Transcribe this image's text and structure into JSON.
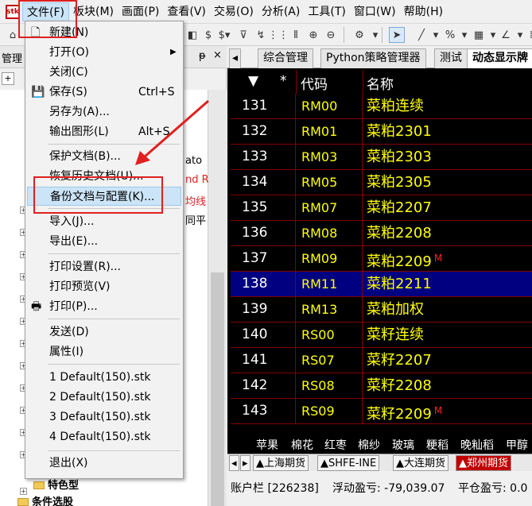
{
  "menubar": {
    "logo": "stk",
    "items": [
      "文件(F)",
      "板块(M)",
      "画面(P)",
      "查看(V)",
      "交易(O)",
      "分析(A)",
      "工具(T)",
      "窗口(W)",
      "帮助(H)"
    ]
  },
  "toolbar": {
    "icons": [
      "home-icon",
      "back-icon",
      "forward-icon",
      "grid-icon",
      "zoom-in-icon",
      "zoom-out-icon",
      "gear-icon",
      "cursor-icon",
      "line-icon",
      "percent-icon",
      "table-icon",
      "angle-icon"
    ]
  },
  "left_panel": {
    "title": "管理",
    "pin": "ᵽ",
    "close": "×",
    "behind_texts": [
      "ato",
      "nd R",
      "均线",
      "同平"
    ],
    "tree": [
      {
        "label": "特色型"
      },
      {
        "label": "条件选股"
      }
    ]
  },
  "file_menu": {
    "items": [
      {
        "label": "新建(N)",
        "shortcut": "",
        "icon": "new-doc"
      },
      {
        "label": "打开(O)",
        "shortcut": "",
        "submenu": true
      },
      {
        "label": "关闭(C)",
        "shortcut": ""
      },
      {
        "label": "保存(S)",
        "shortcut": "Ctrl+S",
        "icon": "save"
      },
      {
        "label": "另存为(A)...",
        "shortcut": ""
      },
      {
        "label": "输出图形(L)",
        "shortcut": "Alt+S"
      },
      {
        "label": "保护文档(B)...",
        "shortcut": ""
      },
      {
        "label": "恢复历史文档(U)...",
        "shortcut": ""
      },
      {
        "label": "备份文档与配置(K)...",
        "shortcut": "",
        "highlighted": true
      },
      {
        "label": "导入(J)...",
        "shortcut": ""
      },
      {
        "label": "导出(E)...",
        "shortcut": ""
      },
      {
        "label": "打印设置(R)...",
        "shortcut": ""
      },
      {
        "label": "打印预览(V)",
        "shortcut": ""
      },
      {
        "label": "打印(P)...",
        "shortcut": "",
        "icon": "print"
      },
      {
        "label": "发送(D)",
        "shortcut": ""
      },
      {
        "label": "属性(I)",
        "shortcut": ""
      },
      {
        "label": "1 Default(150).stk",
        "shortcut": ""
      },
      {
        "label": "2 Default(150).stk",
        "shortcut": ""
      },
      {
        "label": "3 Default(150).stk",
        "shortcut": ""
      },
      {
        "label": "4 Default(150).stk",
        "shortcut": ""
      },
      {
        "label": "退出(X)",
        "shortcut": ""
      }
    ]
  },
  "tabs": [
    "综合管理",
    "Python策略管理器",
    "测试",
    "动态显示牌"
  ],
  "table": {
    "headers": {
      "sort": "▼",
      "star": "*",
      "code": "代码",
      "name": "名称"
    },
    "rows": [
      {
        "num": "131",
        "code": "RM00",
        "name": "菜粕连续"
      },
      {
        "num": "132",
        "code": "RM01",
        "name": "菜粕2301"
      },
      {
        "num": "133",
        "code": "RM03",
        "name": "菜粕2303"
      },
      {
        "num": "134",
        "code": "RM05",
        "name": "菜粕2305"
      },
      {
        "num": "135",
        "code": "RM07",
        "name": "菜粕2207"
      },
      {
        "num": "136",
        "code": "RM08",
        "name": "菜粕2208"
      },
      {
        "num": "137",
        "code": "RM09",
        "name": "菜粕2209",
        "mark": "M"
      },
      {
        "num": "138",
        "code": "RM11",
        "name": "菜粕2211",
        "selected": true
      },
      {
        "num": "139",
        "code": "RM13",
        "name": "菜粕加权"
      },
      {
        "num": "140",
        "code": "RS00",
        "name": "菜籽连续"
      },
      {
        "num": "141",
        "code": "RS07",
        "name": "菜籽2207"
      },
      {
        "num": "142",
        "code": "RS08",
        "name": "菜籽2208"
      },
      {
        "num": "143",
        "code": "RS09",
        "name": "菜籽2209",
        "mark": "M"
      }
    ]
  },
  "categories": [
    "苹果",
    "棉花",
    "红枣",
    "棉纱",
    "玻璃",
    "粳稻",
    "晚籼稻",
    "甲醇"
  ],
  "market_tabs": [
    {
      "label": "▲上海期货",
      "active": false
    },
    {
      "label": "▲SHFE-INE",
      "active": false
    },
    {
      "label": "▲大连期货",
      "active": false
    },
    {
      "label": "▲郑州期货",
      "active": true
    }
  ],
  "status_bar": {
    "account": "账户栏 [226238]",
    "floating_pl": "浮动盈亏: -79,039.07",
    "close_pl": "平仓盈亏: 0.0"
  }
}
